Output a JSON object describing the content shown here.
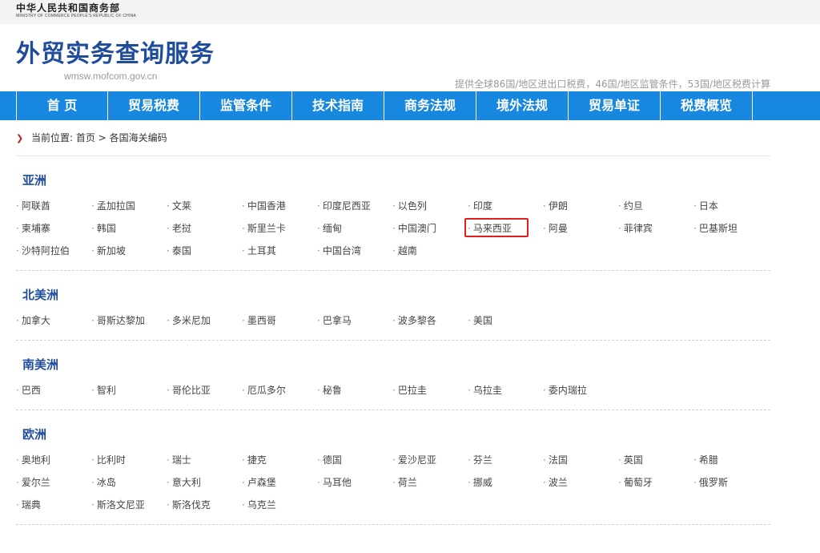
{
  "topbar": {
    "ministry_cn": "中华人民共和国商务部",
    "ministry_en": "MINISTRY OF COMMERCE PEOPLE'S REPUBLIC OF CHINA"
  },
  "header": {
    "title": "外贸实务查询服务",
    "domain": "wmsw.mofcom.gov.cn",
    "tagline": "提供全球86国/地区进出口税费，46国/地区监管条件，53国/地区税费计算"
  },
  "nav": [
    "首 页",
    "贸易税费",
    "监管条件",
    "技术指南",
    "商务法规",
    "境外法规",
    "贸易单证",
    "税费概览"
  ],
  "breadcrumb": {
    "prefix": "当前位置:",
    "home": "首页",
    "separator": ">",
    "current": "各国海关编码"
  },
  "regions": [
    {
      "title": "亚洲",
      "countries": [
        "阿联酋",
        "孟加拉国",
        "文莱",
        "中国香港",
        "印度尼西亚",
        "以色列",
        "印度",
        "伊朗",
        "约旦",
        "日本",
        "柬埔寨",
        "韩国",
        "老挝",
        "斯里兰卡",
        "缅甸",
        "中国澳门",
        "马来西亚",
        "阿曼",
        "菲律宾",
        "巴基斯坦",
        "沙特阿拉伯",
        "新加坡",
        "泰国",
        "土耳其",
        "中国台湾",
        "越南"
      ]
    },
    {
      "title": "北美洲",
      "countries": [
        "加拿大",
        "哥斯达黎加",
        "多米尼加",
        "墨西哥",
        "巴拿马",
        "波多黎各",
        "美国"
      ]
    },
    {
      "title": "南美洲",
      "countries": [
        "巴西",
        "智利",
        "哥伦比亚",
        "厄瓜多尔",
        "秘鲁",
        "巴拉圭",
        "乌拉圭",
        "委内瑞拉"
      ]
    },
    {
      "title": "欧洲",
      "countries": [
        "奥地利",
        "比利时",
        "瑞士",
        "捷克",
        "德国",
        "爱沙尼亚",
        "芬兰",
        "法国",
        "英国",
        "希腊",
        "爱尔兰",
        "冰岛",
        "意大利",
        "卢森堡",
        "马耳他",
        "荷兰",
        "挪威",
        "波兰",
        "葡萄牙",
        "俄罗斯",
        "瑞典",
        "斯洛文尼亚",
        "斯洛伐克",
        "乌克兰"
      ]
    }
  ],
  "highlight_color": "#e02020",
  "brand_color": "#1f4d9c",
  "nav_color": "#1787e0"
}
